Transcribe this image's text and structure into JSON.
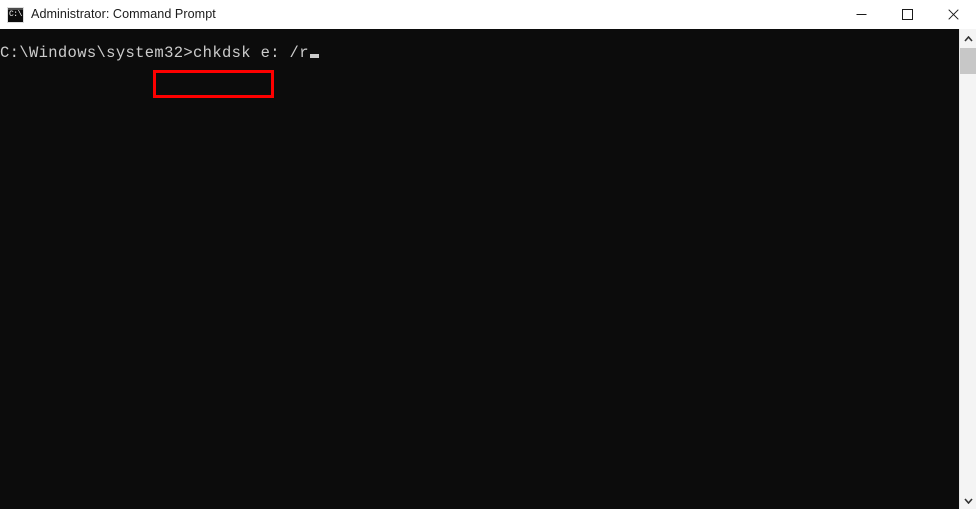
{
  "window": {
    "title": "Administrator: Command Prompt",
    "icon": "command-prompt-icon",
    "icon_glyph": "C:\\",
    "background_color": "#0c0c0c"
  },
  "titlebar": {
    "minimize_label": "Minimize",
    "maximize_label": "Maximize",
    "close_label": "Close"
  },
  "terminal": {
    "prompt": "C:\\Windows\\system32>",
    "command": "chkdsk e: /r",
    "full_line": "C:\\Windows\\system32>chkdsk e: /r",
    "text_color": "#cccccc",
    "cursor": "block-cursor"
  },
  "annotation": {
    "type": "rectangle-highlight",
    "color": "#fe0000",
    "target_text": "chkdsk e: /r"
  },
  "scrollbar": {
    "up_arrow": "∧",
    "down_arrow": "∨",
    "position": "top"
  }
}
